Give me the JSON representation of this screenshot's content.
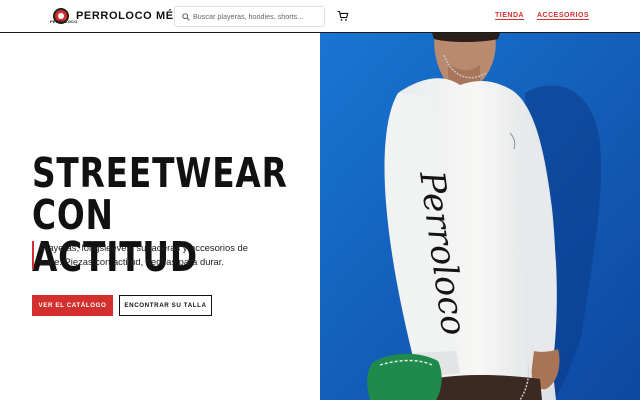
{
  "header": {
    "logo_text": "PERROLOCO",
    "brand_name": "PERROLOCO MÉXICO",
    "search_placeholder": "Buscar playeras, hoodies, shorts...",
    "nav": [
      {
        "label": "TIENDA"
      },
      {
        "label": "ACCESORIOS"
      }
    ],
    "icons": {
      "search": "search-icon",
      "cart": "cart-icon",
      "logo": "logo-icon"
    }
  },
  "hero": {
    "title_line1": "STREETWEAR",
    "title_line2": "CON ACTITUD",
    "description": "Playeras, longsleeves, sudaderas y accesorios de calle. Piezas con actitud, hechas para durar.",
    "primary_button": "VER EL CATÁLOGO",
    "secondary_button": "ENCONTRAR SU TALLA",
    "sleeve_print": "Perroloco"
  },
  "colors": {
    "accent": "#d32f2f",
    "text": "#111111",
    "hero_background": "#1565c0"
  }
}
